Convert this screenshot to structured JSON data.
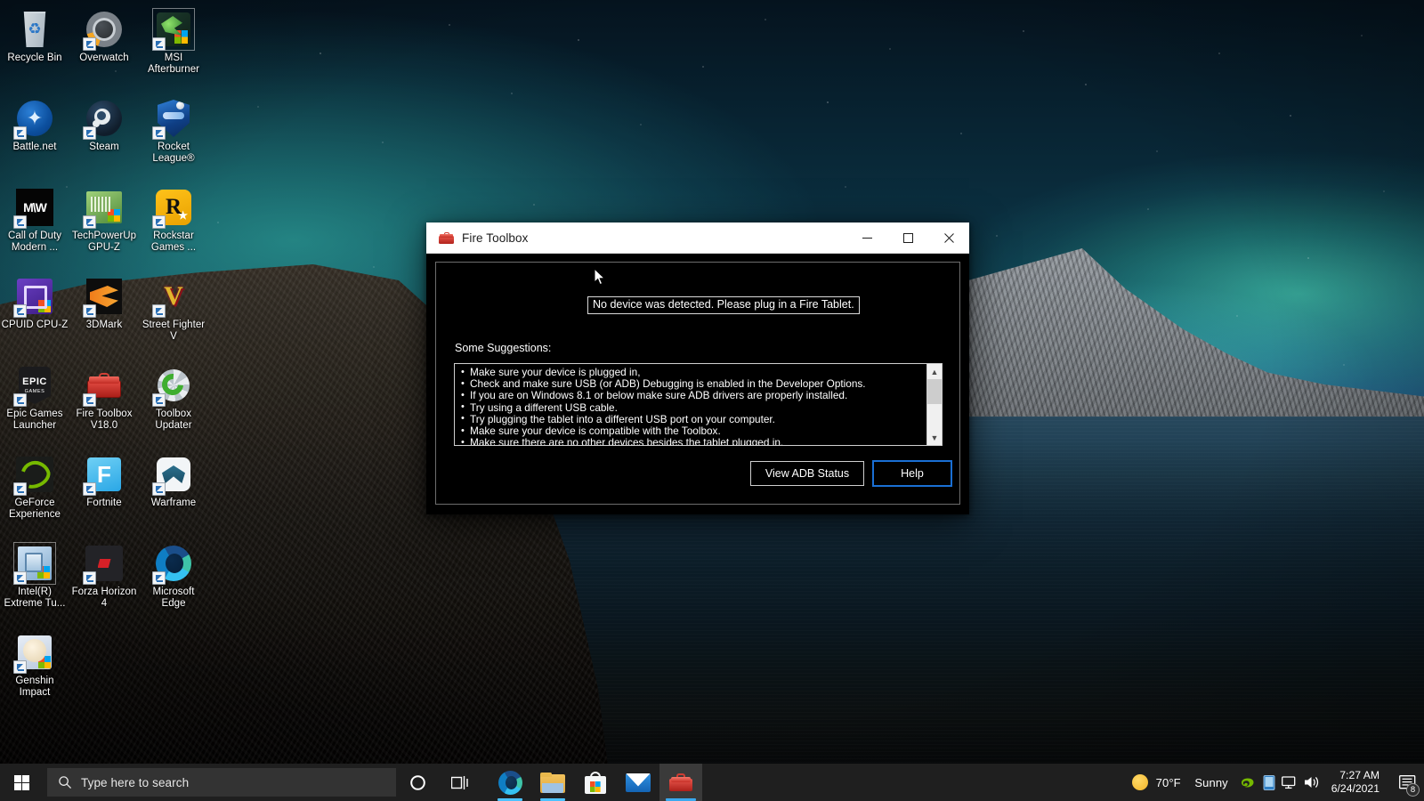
{
  "desktop": {
    "icons": [
      {
        "label": "Recycle Bin",
        "art": "recycle",
        "shortcut": false,
        "selected": false
      },
      {
        "label": "Overwatch",
        "art": "ow",
        "shortcut": true,
        "selected": false
      },
      {
        "label": "MSI Afterburner",
        "art": "msi",
        "shortcut": true,
        "selected": true
      },
      {
        "label": "Battle.net",
        "art": "bnet",
        "shortcut": true,
        "selected": false
      },
      {
        "label": "Steam",
        "art": "steam",
        "shortcut": true,
        "selected": false
      },
      {
        "label": "Rocket League®",
        "art": "rl",
        "shortcut": true,
        "selected": false
      },
      {
        "label": "Call of Duty Modern ...",
        "art": "mw",
        "shortcut": true,
        "selected": false
      },
      {
        "label": "TechPowerUp GPU-Z",
        "art": "gpuz",
        "shortcut": true,
        "selected": false
      },
      {
        "label": "Rockstar Games ...",
        "art": "rockstar",
        "shortcut": true,
        "selected": false
      },
      {
        "label": "CPUID CPU-Z",
        "art": "cpuz",
        "shortcut": true,
        "selected": false
      },
      {
        "label": "3DMark",
        "art": "3dmark",
        "shortcut": true,
        "selected": false
      },
      {
        "label": "Street Fighter V",
        "art": "sfv",
        "shortcut": true,
        "selected": false
      },
      {
        "label": "Epic Games Launcher",
        "art": "epic",
        "shortcut": true,
        "selected": false
      },
      {
        "label": "Fire Toolbox V18.0",
        "art": "toolbox",
        "shortcut": true,
        "selected": false
      },
      {
        "label": "Toolbox Updater",
        "art": "updater",
        "shortcut": true,
        "selected": false
      },
      {
        "label": "GeForce Experience",
        "art": "geforce",
        "shortcut": true,
        "selected": false
      },
      {
        "label": "Fortnite",
        "art": "fortnite",
        "shortcut": true,
        "selected": false
      },
      {
        "label": "Warframe",
        "art": "warframe",
        "shortcut": true,
        "selected": false
      },
      {
        "label": "Intel(R) Extreme Tu...",
        "art": "intel",
        "shortcut": true,
        "selected": true
      },
      {
        "label": "Forza Horizon 4",
        "art": "forza",
        "shortcut": true,
        "selected": false
      },
      {
        "label": "Microsoft Edge",
        "art": "edge",
        "shortcut": true,
        "selected": false
      },
      {
        "label": "Genshin Impact",
        "art": "genshin",
        "shortcut": true,
        "selected": false
      }
    ]
  },
  "window": {
    "title": "Fire Toolbox",
    "icon": "toolbox-icon",
    "controls": {
      "minimize": "minimize-button",
      "maximize": "maximize-button",
      "close": "close-button"
    },
    "status_message": "No device was detected. Please plug in a Fire Tablet.",
    "suggestions_label": "Some Suggestions:",
    "suggestions": [
      "Make sure your device is plugged in,",
      "Check and make sure USB (or ADB) Debugging is enabled in the Developer Options.",
      "If you are on Windows 8.1 or below make sure ADB drivers are properly installed.",
      "Try using a different USB cable.",
      "Try plugging the tablet into a different USB port on your computer.",
      "Make sure your device is compatible with the Toolbox.",
      "Make sure there are no other devices besides the tablet plugged in."
    ],
    "buttons": {
      "view_adb_status": "View ADB Status",
      "help": "Help"
    },
    "accent_focus_color": "#1a6fd4"
  },
  "taskbar": {
    "start_label": "Start",
    "search_placeholder": "Type here to search",
    "cortana_label": "Cortana",
    "task_view_label": "Task View",
    "apps": [
      {
        "name": "microsoft-edge",
        "label": "Microsoft Edge",
        "active": false,
        "running": true
      },
      {
        "name": "file-explorer",
        "label": "File Explorer",
        "active": false,
        "running": true
      },
      {
        "name": "microsoft-store",
        "label": "Microsoft Store",
        "active": false,
        "running": false
      },
      {
        "name": "mail",
        "label": "Mail",
        "active": false,
        "running": false
      },
      {
        "name": "fire-toolbox",
        "label": "Fire Toolbox",
        "active": true,
        "running": true
      }
    ],
    "weather": {
      "temperature": "70°F",
      "condition": "Sunny"
    },
    "tray_icons": [
      "nvidia-icon",
      "onedrive-icon",
      "network-icon",
      "volume-icon"
    ],
    "clock": {
      "time": "7:27 AM",
      "date": "6/24/2021"
    },
    "notifications_count": "8"
  }
}
